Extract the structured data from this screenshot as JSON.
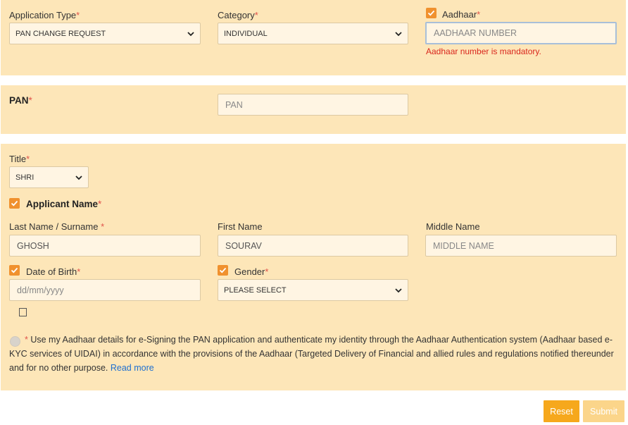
{
  "required_mark": "*",
  "application_type": {
    "label": "Application Type",
    "value": "PAN CHANGE REQUEST"
  },
  "category": {
    "label": "Category",
    "value": "INDIVIDUAL"
  },
  "aadhaar": {
    "label": "Aadhaar",
    "placeholder": "AADHAAR NUMBER",
    "error": "Aadhaar number is mandatory."
  },
  "pan": {
    "label": "PAN",
    "placeholder": "PAN"
  },
  "title_field": {
    "label": "Title",
    "value": "SHRI"
  },
  "applicant_name": {
    "label": "Applicant Name"
  },
  "last_name": {
    "label": "Last Name / Surname",
    "value": "GHOSH"
  },
  "first_name": {
    "label": "First Name",
    "value": "SOURAV"
  },
  "middle_name": {
    "label": "Middle Name",
    "placeholder": "MIDDLE NAME"
  },
  "dob": {
    "label": "Date of Birth",
    "placeholder": "dd/mm/yyyy"
  },
  "gender": {
    "label": "Gender",
    "value": "PLEASE SELECT"
  },
  "consent": {
    "text": " Use my Aadhaar details for e-Signing the PAN application and authenticate my identity through the Aadhaar Authentication system (Aadhaar based e-KYC services of UIDAI) in accordance with the provisions of the Aadhaar (Targeted Delivery of Financial and allied rules and regulations notified thereunder and for no other purpose. ",
    "link": "Read more"
  },
  "buttons": {
    "reset": "Reset",
    "submit": "Submit"
  },
  "colors": {
    "panel_bg": "#fde6b8",
    "checkbox": "#f0912e",
    "reset": "#f6a81c",
    "submit": "#fbd58a",
    "error": "#d9261c",
    "link": "#1e6fd0"
  }
}
